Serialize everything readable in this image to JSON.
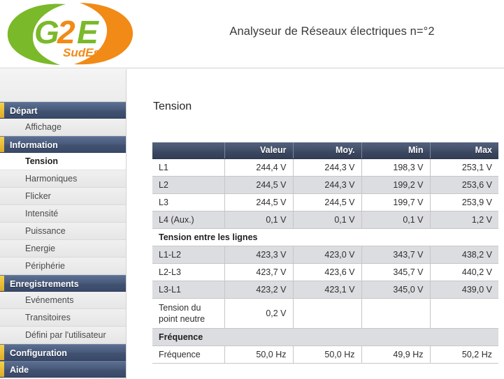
{
  "header": {
    "title": "Analyseur de Réseaux électriques n=°2",
    "logo": {
      "main_text": "G2E",
      "sub_text": "SudEst",
      "green": "#7ab929",
      "orange": "#f18a16"
    }
  },
  "sidebar": {
    "items": [
      {
        "label": "Départ",
        "type": "group",
        "active": false
      },
      {
        "label": "Affichage",
        "type": "item",
        "active": false
      },
      {
        "label": "Information",
        "type": "group",
        "active": false
      },
      {
        "label": "Tension",
        "type": "item",
        "active": true
      },
      {
        "label": "Harmoniques",
        "type": "item",
        "active": false
      },
      {
        "label": "Flicker",
        "type": "item",
        "active": false
      },
      {
        "label": "Intensité",
        "type": "item",
        "active": false
      },
      {
        "label": "Puissance",
        "type": "item",
        "active": false
      },
      {
        "label": "Energie",
        "type": "item",
        "active": false
      },
      {
        "label": "Périphérie",
        "type": "item",
        "active": false
      },
      {
        "label": "Enregistrements",
        "type": "group",
        "active": false
      },
      {
        "label": "Evénements",
        "type": "item",
        "active": false
      },
      {
        "label": "Transitoires",
        "type": "item",
        "active": false
      },
      {
        "label": "Défini par l'utilisateur",
        "type": "item",
        "active": false
      },
      {
        "label": "Configuration",
        "type": "group",
        "active": false
      },
      {
        "label": "Aide",
        "type": "group",
        "active": false
      }
    ]
  },
  "main": {
    "page_title": "Tension",
    "table": {
      "columns": [
        "",
        "Valeur",
        "Moy.",
        "Min",
        "Max"
      ],
      "rows": [
        {
          "kind": "data",
          "shade": "plain",
          "cells": [
            "L1",
            "244,4 V",
            "244,3 V",
            "198,3 V",
            "253,1 V"
          ]
        },
        {
          "kind": "data",
          "shade": "shade",
          "cells": [
            "L2",
            "244,5 V",
            "244,3 V",
            "199,2 V",
            "253,6 V"
          ]
        },
        {
          "kind": "data",
          "shade": "plain",
          "cells": [
            "L3",
            "244,5 V",
            "244,5 V",
            "199,7 V",
            "253,9 V"
          ]
        },
        {
          "kind": "data",
          "shade": "shade",
          "cells": [
            "L4 (Aux.)",
            "0,1 V",
            "0,1 V",
            "0,1 V",
            "1,2 V"
          ]
        },
        {
          "kind": "section",
          "shade": "plain",
          "cells": [
            "Tension entre les lignes",
            "",
            "",
            "",
            ""
          ]
        },
        {
          "kind": "data",
          "shade": "shade",
          "cells": [
            "L1-L2",
            "423,3 V",
            "423,0 V",
            "343,7 V",
            "438,2 V"
          ]
        },
        {
          "kind": "data",
          "shade": "plain",
          "cells": [
            "L2-L3",
            "423,7 V",
            "423,6 V",
            "345,7 V",
            "440,2 V"
          ]
        },
        {
          "kind": "data",
          "shade": "shade",
          "cells": [
            "L3-L1",
            "423,2 V",
            "423,1 V",
            "345,0 V",
            "439,0 V"
          ]
        },
        {
          "kind": "tall",
          "shade": "plain",
          "cells": [
            "Tension du point neutre",
            "0,2 V",
            "",
            "",
            ""
          ]
        },
        {
          "kind": "section",
          "shade": "shade",
          "cells": [
            "Fréquence",
            "",
            "",
            "",
            ""
          ]
        },
        {
          "kind": "data",
          "shade": "plain",
          "cells": [
            "Fréquence",
            "50,0 Hz",
            "50,0 Hz",
            "49,9 Hz",
            "50,2 Hz"
          ]
        }
      ]
    }
  }
}
